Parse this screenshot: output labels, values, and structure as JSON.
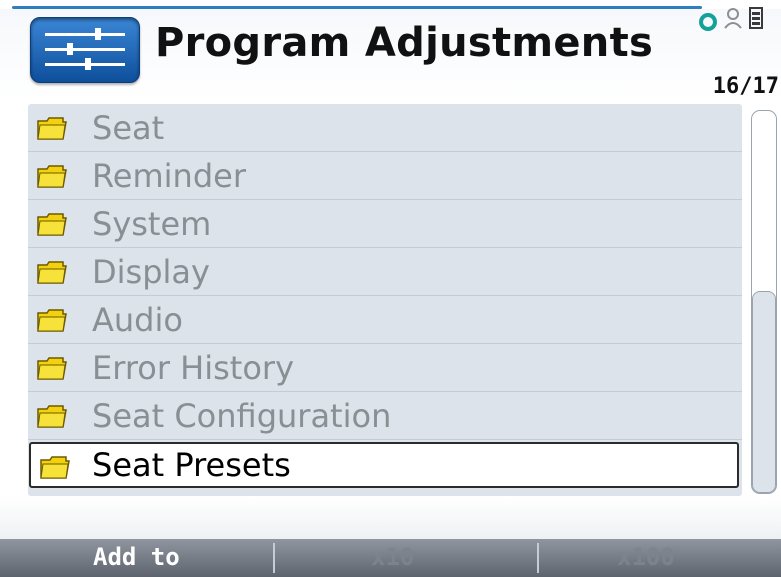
{
  "header": {
    "title": "Program Adjustments",
    "counter": "16/17",
    "app_icon": "sliders-icon",
    "status_icons": [
      "connection-ring-icon",
      "person-key-icon",
      "battery-icon"
    ]
  },
  "menu": {
    "items": [
      {
        "label": "Seat",
        "icon": "folder-icon"
      },
      {
        "label": "Reminder",
        "icon": "folder-icon"
      },
      {
        "label": "System",
        "icon": "folder-icon"
      },
      {
        "label": "Display",
        "icon": "folder-icon"
      },
      {
        "label": "Audio",
        "icon": "folder-icon"
      },
      {
        "label": "Error History",
        "icon": "folder-icon"
      },
      {
        "label": "Seat Configuration",
        "icon": "folder-icon"
      },
      {
        "label": "Seat Presets",
        "icon": "folder-icon",
        "selected": true
      }
    ]
  },
  "softkeys": {
    "add_to": "Add to",
    "x10": "x10",
    "x100": "x100"
  },
  "colors": {
    "accent": "#2f7fc0",
    "list_bg": "#dde3ea",
    "folder": "#f2d20a",
    "softkey_bar": "#6f757e"
  }
}
